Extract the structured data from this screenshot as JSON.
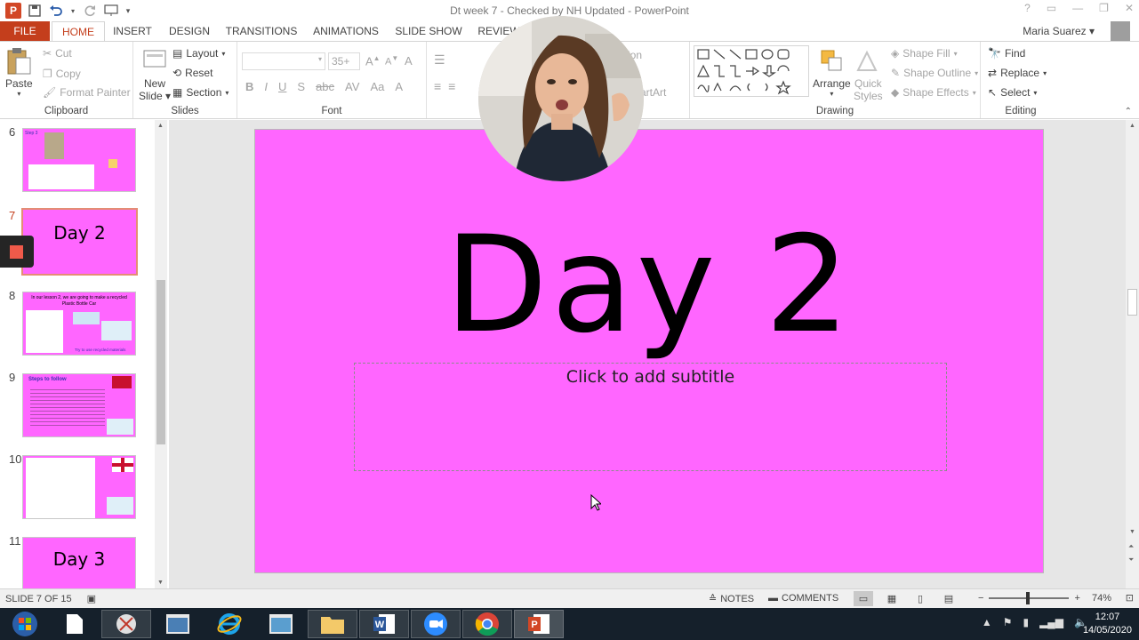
{
  "window": {
    "title": "Dt week 7 - Checked by NH Updated - PowerPoint",
    "help": "?",
    "user": "Maria Suarez"
  },
  "tabs": [
    "FILE",
    "HOME",
    "INSERT",
    "DESIGN",
    "TRANSITIONS",
    "ANIMATIONS",
    "SLIDE SHOW",
    "REVIEW"
  ],
  "ribbon": {
    "clipboard": {
      "label": "Clipboard",
      "paste": "Paste",
      "cut": "Cut",
      "copy": "Copy",
      "format_painter": "Format Painter"
    },
    "slides": {
      "label": "Slides",
      "new_slide_line1": "New",
      "new_slide_line2": "Slide",
      "layout": "Layout",
      "reset": "Reset",
      "section": "Section"
    },
    "font": {
      "label": "Font",
      "size": "35+",
      "bold": "B",
      "italic": "I",
      "underline": "U",
      "shadow": "S",
      "strike": "abc",
      "spacing": "AV",
      "case": "Aa",
      "color": "A"
    },
    "paragraph": {
      "partial_label": "ion",
      "smartart": "artArt"
    },
    "drawing": {
      "label": "Drawing",
      "arrange": "Arrange",
      "quick_styles_1": "Quick",
      "quick_styles_2": "Styles",
      "shape_fill": "Shape Fill",
      "shape_outline": "Shape Outline",
      "shape_effects": "Shape Effects"
    },
    "editing": {
      "label": "Editing",
      "find": "Find",
      "replace": "Replace",
      "select": "Select"
    }
  },
  "thumbnails": [
    {
      "num": "6",
      "title": "",
      "header": "Step 3"
    },
    {
      "num": "7",
      "title": "Day 2",
      "active": true
    },
    {
      "num": "8",
      "title": "",
      "header": "In our lesson 2, we are going to make a recycled Plastic Bottle Car",
      "footer": "Try to use recycled materials"
    },
    {
      "num": "9",
      "title": "",
      "header": "Steps to follow"
    },
    {
      "num": "10",
      "title": ""
    },
    {
      "num": "11",
      "title": "Day 3"
    }
  ],
  "slide": {
    "title": "Day 2",
    "subtitle_placeholder": "Click to add subtitle",
    "background": "#ff66ff"
  },
  "status": {
    "slide_count": "SLIDE 7 OF 15",
    "notes": "NOTES",
    "comments": "COMMENTS",
    "zoom": "74%",
    "minus": "−",
    "plus": "+"
  },
  "taskbar": {
    "time": "12:07",
    "date": "14/05/2020"
  },
  "colors": {
    "accent": "#c43e1c",
    "slide_bg": "#ff66ff",
    "taskbar": "#15202b"
  }
}
